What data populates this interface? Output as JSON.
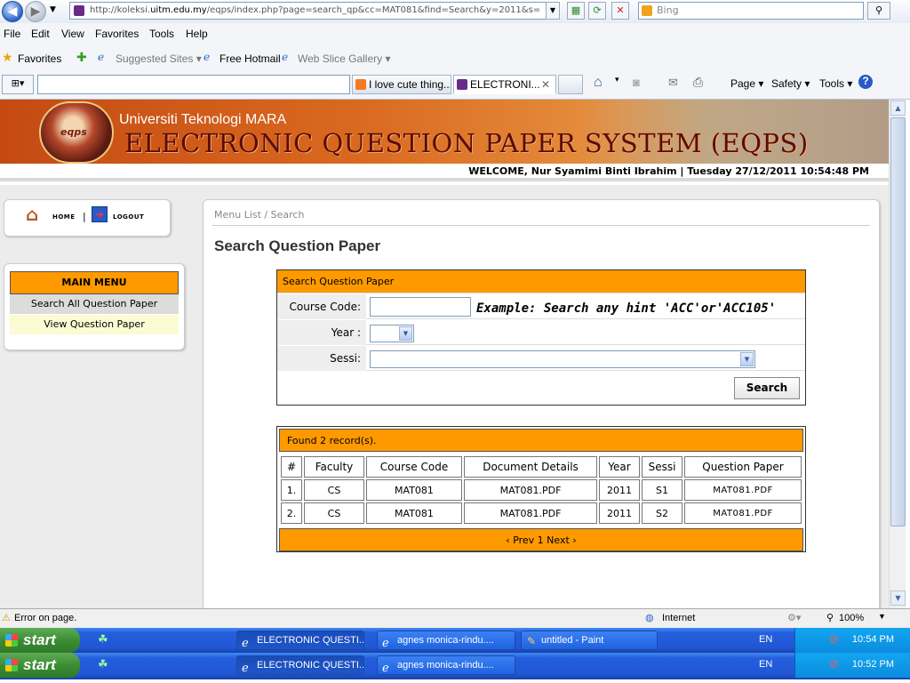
{
  "browser": {
    "url_prefix": "http://koleksi.",
    "url_domain": "uitm.edu.my",
    "url_rest": "/eqps/index.php?page=search_qp&cc=MAT081&find=Search&y=2011&s=",
    "search_placeholder": "Bing",
    "menu": [
      "File",
      "Edit",
      "View",
      "Favorites",
      "Tools",
      "Help"
    ],
    "favorites_label": "Favorites",
    "fav_links": [
      "Suggested Sites ▾",
      "Free Hotmail",
      "Web Slice Gallery ▾"
    ],
    "tabs": [
      "I love cute thing...",
      "ELECTRONI..."
    ],
    "commands": [
      "Page ▾",
      "Safety ▾",
      "Tools ▾"
    ]
  },
  "site": {
    "university": "Universiti Teknologi MARA",
    "system_name": "ELECTRONIC QUESTION PAPER SYSTEM (EQPS)",
    "logo_text": "eqps",
    "welcome": "WELCOME, Nur Syamimi Binti Ibrahim | Tuesday 27/12/2011 10:54:48 PM"
  },
  "nav": {
    "home": "HOME",
    "separator": "|",
    "logout": "LOGOUT"
  },
  "main_menu": {
    "title": "MAIN MENU",
    "items": [
      "Search All Question Paper",
      "View Question Paper"
    ]
  },
  "content": {
    "breadcrumb": "Menu List / Search",
    "title": "Search Question Paper"
  },
  "search_form": {
    "header": "Search Question Paper",
    "course_code_label": "Course Code:",
    "course_code_value": "",
    "example": "Example: Search any hint 'ACC'or'ACC105'",
    "year_label": "Year :",
    "year_value": "",
    "sessi_label": "Sessi:",
    "sessi_value": "",
    "search_button": "Search"
  },
  "results": {
    "found": "Found 2 record(s).",
    "columns": [
      "#",
      "Faculty",
      "Course Code",
      "Document Details",
      "Year",
      "Sessi",
      "Question Paper"
    ],
    "rows": [
      [
        "1.",
        "CS",
        "MAT081",
        "MAT081.PDF",
        "2011",
        "S1",
        "MAT081.PDF"
      ],
      [
        "2.",
        "CS",
        "MAT081",
        "MAT081.PDF",
        "2011",
        "S2",
        "MAT081.PDF"
      ]
    ],
    "pager": "‹ Prev 1 Next ›"
  },
  "status_bar": {
    "message": "Error on page.",
    "zone": "Internet",
    "zoom": "100%"
  },
  "taskbars": [
    {
      "start": "start",
      "items": [
        "ELECTRONIC QUESTI...",
        "agnes monica-rindu....",
        "untitled - Paint"
      ],
      "lang": "EN",
      "time": "10:54 PM"
    },
    {
      "start": "start",
      "items": [
        "ELECTRONIC QUESTI...",
        "agnes monica-rindu...."
      ],
      "lang": "EN",
      "time": "10:52 PM"
    }
  ],
  "colors": {
    "accent": "#ff9900",
    "banner": "#d9691f",
    "taskbar": "#245edc"
  }
}
